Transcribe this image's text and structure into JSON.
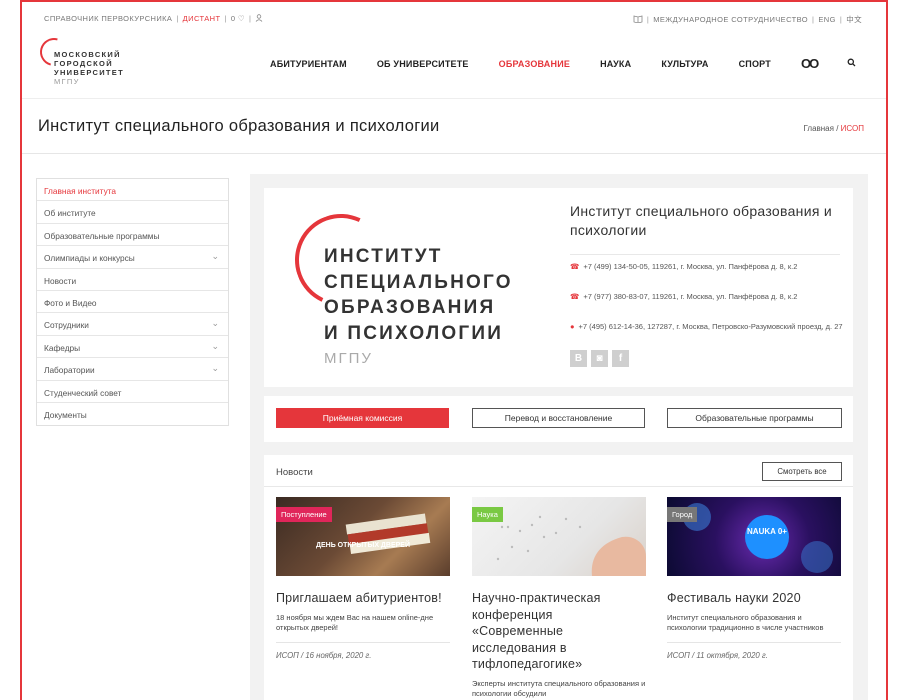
{
  "topbar": {
    "guide": "СПРАВОЧНИК ПЕРВОКУРСНИКА",
    "distant": "ДИСТАНТ",
    "zero_heart": "0 ♡",
    "user_icon": "user-icon",
    "book_icon": "book-icon",
    "international": "МЕЖДУНАРОДНОЕ СОТРУДНИЧЕСТВО",
    "eng": "ENG",
    "cn": "中文"
  },
  "logo": {
    "line1": "МОСКОВСКИЙ",
    "line2": "ГОРОДСКОЙ",
    "line3": "УНИВЕРСИТЕТ",
    "line4": "МГПУ"
  },
  "nav": {
    "items": [
      "АБИТУРИЕНТАМ",
      "ОБ УНИВЕРСИТЕТЕ",
      "ОБРАЗОВАНИЕ",
      "НАУКА",
      "КУЛЬТУРА",
      "СПОРТ"
    ],
    "glasses": "OO",
    "search": "⚲"
  },
  "page": {
    "title": "Институт специального образования и психологии",
    "crumb_home": "Главная",
    "crumb_sep": "/",
    "crumb_current": "ИСОП"
  },
  "sidebar": {
    "items": [
      {
        "label": "Главная института"
      },
      {
        "label": "Об институте"
      },
      {
        "label": "Образовательные программы"
      },
      {
        "label": "Олимпиады и конкурсы"
      },
      {
        "label": "Новости"
      },
      {
        "label": "Фото и Видео"
      },
      {
        "label": "Сотрудники"
      },
      {
        "label": "Кафедры"
      },
      {
        "label": "Лаборатории"
      },
      {
        "label": "Студенческий совет"
      },
      {
        "label": "Документы"
      }
    ],
    "chevron": "⌄"
  },
  "institute": {
    "logo_l1": "ИНСТИТУТ",
    "logo_l2": "СПЕЦИАЛЬНОГО",
    "logo_l3": "ОБРАЗОВАНИЯ",
    "logo_l4": "И ПСИХОЛОГИИ",
    "logo_sub": "МГПУ",
    "name": "Институт специального образования и психологии",
    "phone1": "+7 (499) 134-50-05, 119261, г. Москва, ул. Панфёрова д. 8, к.2",
    "phone2": "+7 (977) 380-83-07, 119261, г. Москва, ул. Панфёрова д. 8, к.2",
    "address": "+7 (495) 612-14-36, 127287, г. Москва, Петровско-Разумовский проезд, д. 27",
    "social_vk": "B",
    "social_ig": "◙",
    "social_fb": "f"
  },
  "buttons": {
    "admission": "Приёмная комиссия",
    "transfer": "Перевод и восстановление",
    "programs": "Образовательные программы"
  },
  "news": {
    "title": "Новости",
    "more": "Смотреть все",
    "items": [
      {
        "tag": "Поступление",
        "img_text": "ДЕНЬ ОТКРЫТЫХ ДВЕРЕЙ",
        "title": "Приглашаем абитуриентов!",
        "desc": "18 ноября мы ждем Вас на нашем online-дне открытых дверей!",
        "date": "ИСОП   /   16 ноября, 2020 г."
      },
      {
        "tag": "Наука",
        "title": "Научно-практическая конференция «Современные исследования в тифлопедагогике»",
        "desc": "Эксперты института специального образования и психологии обсудили"
      },
      {
        "tag": "Город",
        "img_text": "NAUKA 0+",
        "title": "Фестиваль науки 2020",
        "desc": "Институт специального образования и психологии традиционно в числе участников",
        "date": "ИСОП   /   11 октября, 2020 г."
      }
    ]
  },
  "colors": {
    "accent": "#e5363b",
    "tag_admission": "#e0265a",
    "tag_science": "#7ac943",
    "tag_city": "#777777"
  }
}
